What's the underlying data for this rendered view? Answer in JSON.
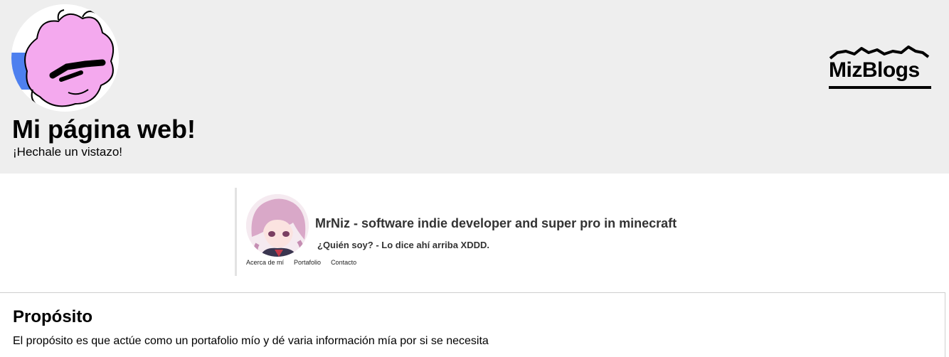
{
  "header": {
    "title": "Mi página web!",
    "subtitle": "¡Hechale un vistazo!",
    "brand": "MizBlogs"
  },
  "profile": {
    "name": "MrNiz - software indie developer and super pro in minecraft",
    "tagline": "¿Quién soy? - Lo dice ahí arriba XDDD.",
    "nav": [
      "Acerca de mí",
      "Portafolio",
      "Contacto"
    ]
  },
  "section": {
    "title": "Propósito",
    "text": "El propósito es que actúe como un portafolio mío y dé varia información mía por si se necesita"
  },
  "colors": {
    "header_bg": "#eeeeee",
    "avatar_pink": "#f4a9ee",
    "card_border": "#e3e3e3"
  }
}
